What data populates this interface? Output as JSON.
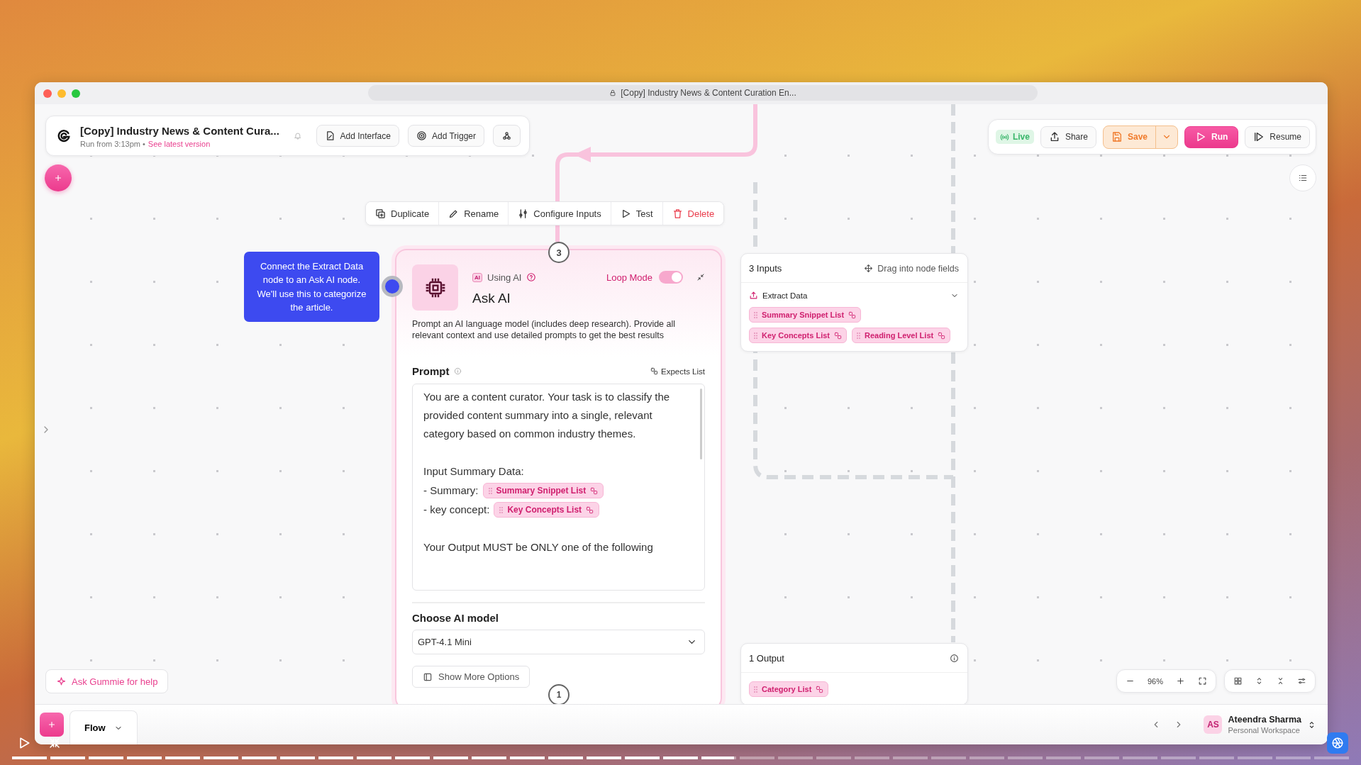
{
  "window": {
    "address": "[Copy] Industry News & Content Curation En..."
  },
  "header": {
    "title": "[Copy] Industry News & Content Cura...",
    "subtitle": "Run from 3:13pm •",
    "link": "See latest version",
    "buttons": [
      "Add Interface",
      "Add Trigger"
    ]
  },
  "toolbar": {
    "status": "Live",
    "buttons": [
      {
        "label": "Share",
        "kind": "plain"
      },
      {
        "label": "Save",
        "kind": "save"
      },
      {
        "label": "Run",
        "kind": "primary"
      },
      {
        "label": "Resume",
        "kind": "resume"
      }
    ]
  },
  "node_actions": [
    {
      "label": "Duplicate",
      "kind": "duplicate"
    },
    {
      "label": "Rename",
      "kind": "rename"
    },
    {
      "label": "Configure Inputs",
      "kind": "configure"
    },
    {
      "label": "Test",
      "kind": "test"
    },
    {
      "label": "Delete",
      "kind": "delete"
    }
  ],
  "tooltip": "Connect the Extract Data node to an Ask AI node. We'll use this to categorize the article.",
  "node": {
    "step": "3",
    "badge_icon": "AI",
    "badge": "Using AI",
    "title": "Ask AI",
    "loop_mode": {
      "label": "Loop Mode",
      "on": true
    },
    "description": "Prompt an AI language model (includes deep research). Provide all relevant context and use detailed prompts to get the best results",
    "prompt_label": "Prompt",
    "expects": "Expects List",
    "prompt": [
      {
        "kind": "paragraph",
        "text": "You are a content curator. Your task is to classify the provided content summary into a single, relevant category based on common industry themes."
      },
      {
        "kind": "paragraph",
        "text": "Input Summary Data:"
      },
      {
        "kind": "line",
        "text": "- Summary:",
        "chip": "Summary Snippet List"
      },
      {
        "kind": "line",
        "text": "- key concept:",
        "chip": "Key Concepts List"
      },
      {
        "kind": "paragraph",
        "text": "Your Output MUST be ONLY one of the following"
      }
    ],
    "model_label": "Choose AI model",
    "model": "GPT-4.1 Mini",
    "more": "Show More Options",
    "next_step": "1"
  },
  "inputs": {
    "title": "3 Inputs",
    "hint": "Drag into node fields",
    "source": "Extract Data",
    "expanded": true,
    "chips": [
      "Summary Snippet List",
      "Key Concepts List",
      "Reading Level List"
    ]
  },
  "outputs": {
    "title": "1 Output",
    "chips": [
      "Category List"
    ]
  },
  "zoom": "96%",
  "help": "Ask Gummie for help",
  "bottom_bar": {
    "tab": "Flow",
    "initials": "AS",
    "user": "Ateendra Sharma",
    "workspace": "Personal Workspace"
  },
  "player": {
    "level": 0.54
  }
}
